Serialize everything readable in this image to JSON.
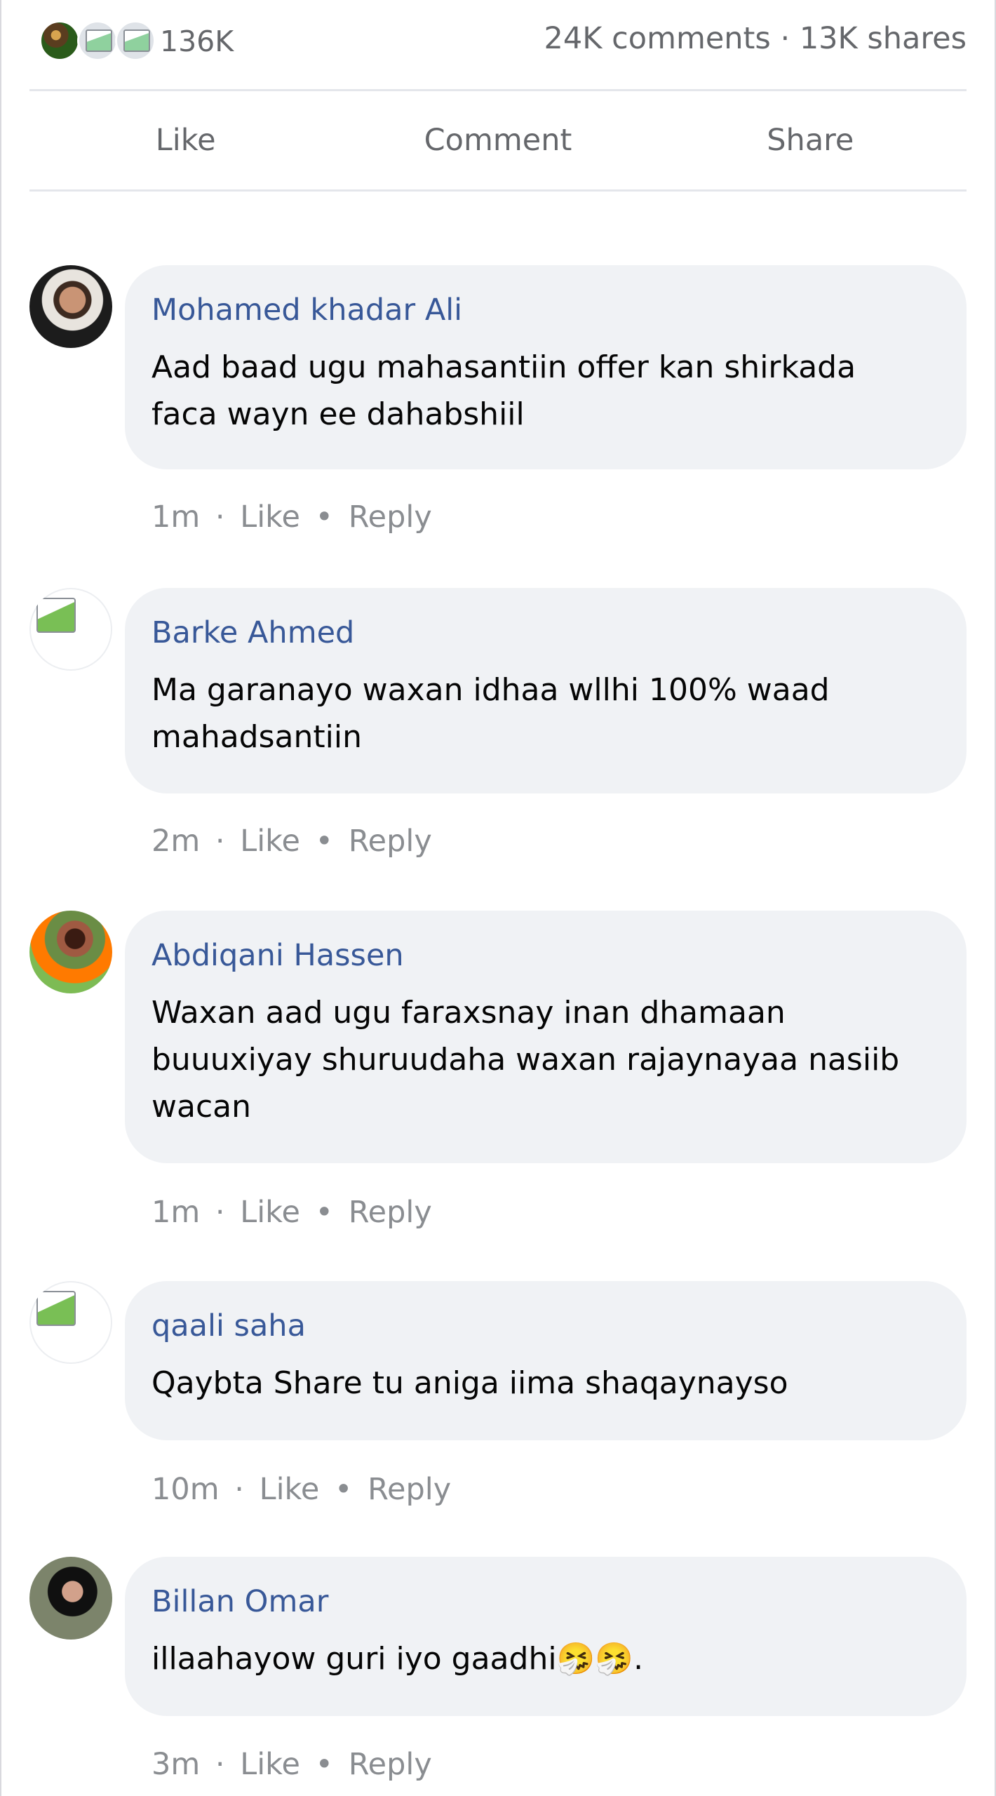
{
  "post_stats": {
    "reaction_count": "136K",
    "comment_share_summary": "24K comments · 13K shares"
  },
  "actions": {
    "like": "Like",
    "comment": "Comment",
    "share": "Share"
  },
  "comments": [
    {
      "author": "Mohamed khadar Ali",
      "text": "Aad baad ugu mahasantiin offer kan shirkada\nfaca wayn ee dahabshiil",
      "time": "1m",
      "like": "Like",
      "reply": "Reply",
      "sep1": "·",
      "sep2": "•"
    },
    {
      "author": "Barke Ahmed",
      "text": "Ma garanayo waxan idhaa wllhi 100% waad\nmahadsantiin",
      "time": "2m",
      "like": "Like",
      "reply": "Reply",
      "sep1": "·",
      "sep2": "•"
    },
    {
      "author": "Abdiqani Hassen",
      "text": "Waxan aad ugu faraxsnay inan dhamaan\nbuuuxiyay shuruudaha waxan rajaynayaa nasiib\nwacan",
      "time": "1m",
      "like": "Like",
      "reply": "Reply",
      "sep1": "·",
      "sep2": "•"
    },
    {
      "author": "qaali saha",
      "text": "Qaybta Share tu aniga iima shaqaynayso",
      "time": "10m",
      "like": "Like",
      "reply": "Reply",
      "sep1": "·",
      "sep2": "•"
    },
    {
      "author": "Billan Omar",
      "text": "illaahayow guri iyo gaadhi🤧🤧.",
      "time": "3m",
      "like": "Like",
      "reply": "Reply",
      "sep1": "·",
      "sep2": "•"
    }
  ]
}
